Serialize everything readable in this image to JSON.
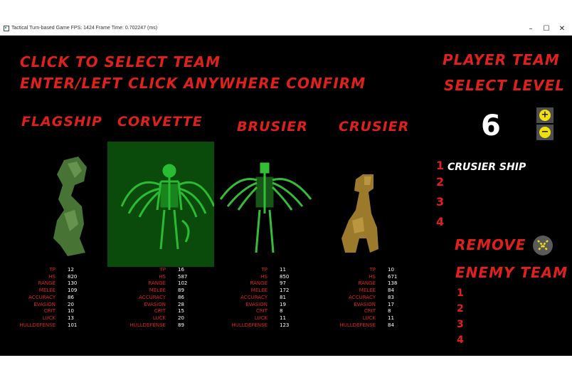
{
  "window": {
    "title": "Tactical Turn-based Game   FPS: 1424   Frame Time: 0.702247 (ms)"
  },
  "instructions": {
    "line1": "Click to select team",
    "line2": "Enter/Left Click anywhere confirm"
  },
  "player_team": {
    "title": "Player Team",
    "select_level": "Select Level",
    "level": "6"
  },
  "enemy_team": {
    "title": "Enemy Team",
    "slots": [
      "1",
      "2",
      "3",
      "4"
    ]
  },
  "remove": {
    "label": "Remove"
  },
  "team_slots": [
    {
      "num": "1",
      "ship": "Crusier Ship"
    },
    {
      "num": "2",
      "ship": ""
    },
    {
      "num": "3",
      "ship": ""
    },
    {
      "num": "4",
      "ship": ""
    }
  ],
  "stat_labels": [
    "TP",
    "HS",
    "Range",
    "Melee",
    "Accuracy",
    "Evasion",
    "Crit",
    "Luck",
    "HullDefense"
  ],
  "ships": [
    {
      "name": "Flagship",
      "selected": false,
      "color": "#4f7f3a",
      "stats": [
        "12",
        "820",
        "130",
        "109",
        "86",
        "20",
        "10",
        "13",
        "101"
      ]
    },
    {
      "name": "Corvette",
      "selected": true,
      "color": "#2fd13a",
      "stats": [
        "16",
        "587",
        "102",
        "89",
        "86",
        "28",
        "15",
        "20",
        "89"
      ]
    },
    {
      "name": "Brusier",
      "selected": false,
      "color": "#3ad33e",
      "stats": [
        "11",
        "850",
        "97",
        "172",
        "81",
        "19",
        "8",
        "11",
        "123"
      ]
    },
    {
      "name": "Crusier",
      "selected": false,
      "color": "#9c7a2c",
      "stats": [
        "10",
        "671",
        "138",
        "84",
        "83",
        "17",
        "8",
        "11",
        "84"
      ]
    }
  ],
  "colors": {
    "accent_red": "#e0201c",
    "highlight_green": "#0a4a0a",
    "button_yellow": "#f0e010"
  }
}
